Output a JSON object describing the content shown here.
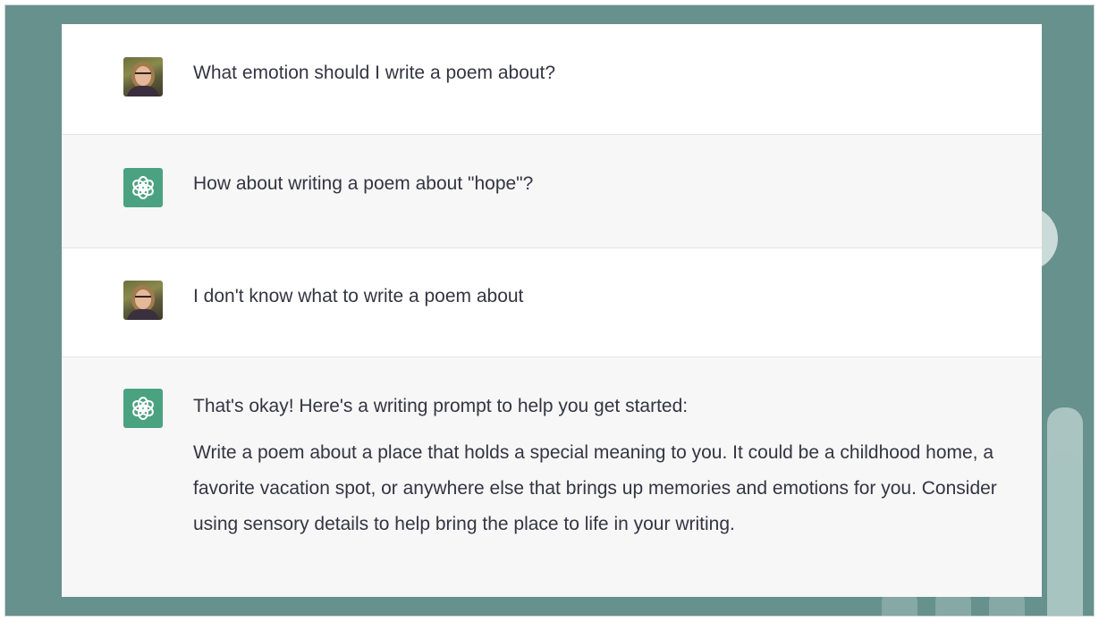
{
  "conversation": {
    "messages": [
      {
        "role": "user",
        "avatar_icon": "user-photo-avatar",
        "text": "What emotion should I write a poem about?"
      },
      {
        "role": "assistant",
        "avatar_icon": "chatgpt-logo-icon",
        "text": "How about writing a poem about \"hope\"?"
      },
      {
        "role": "user",
        "avatar_icon": "user-photo-avatar",
        "text": "I don't know what to write a poem about"
      },
      {
        "role": "assistant",
        "avatar_icon": "chatgpt-logo-icon",
        "paragraphs": [
          "That's okay! Here's a writing prompt to help you get started:",
          "Write a poem about a place that holds a special meaning to you. It could be a childhood home, a favorite vacation spot, or anywhere else that brings up memories and emotions for you. Consider using sensory details to help bring the place to life in your writing."
        ]
      }
    ]
  },
  "colors": {
    "frame_background": "#66918d",
    "assistant_row_background": "#f7f7f8",
    "user_row_background": "#ffffff",
    "assistant_avatar": "#4aa281",
    "text": "#343541"
  }
}
